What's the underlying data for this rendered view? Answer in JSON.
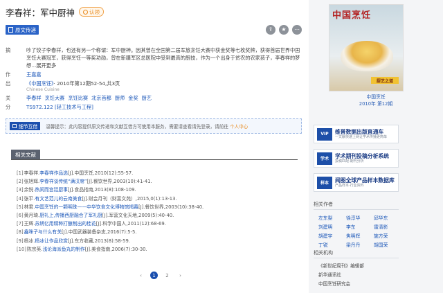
{
  "article": {
    "title": "李春祥：军中厨神",
    "auth_badge": "认领",
    "fulltext_button": "原文传递"
  },
  "tools": [
    {
      "name": "share-icon",
      "glyph": "⇪"
    },
    {
      "name": "favorite-icon",
      "glyph": "★"
    },
    {
      "name": "more-icon",
      "glyph": "⋯"
    }
  ],
  "meta": {
    "abstract_label": "摘",
    "abstract": "吵了饺子李春祥，也还有另一个称谓：军中厨神。因其曾在全国第二届军旅烹饪大赛中获金奖等七枚奖牌，获得首届世界中国烹饪大赛冠军，获得烹饪一等奖功勋，曾在新疆军区总医院中受到最高的厨技，作为一个出身于贫农的农家孩子，李春祥的梦想…展开更多",
    "author_label": "作",
    "author": "王嘉嘉",
    "source_label": "出",
    "source_link": "《中国烹饪》",
    "source_detail": "· 2010年第12期52-54,共3页",
    "source_en": "Chinese Cuisine",
    "keywords_label": "关",
    "keywords": [
      "李春祥",
      "烹饪大赛",
      "烹饪比赛",
      "北京首都",
      "厨师",
      "金奖",
      "厨艺"
    ],
    "class_label": "分",
    "class_value": "TS972.122 [轻工技术与工程]"
  },
  "notice": {
    "button": "细节互借",
    "text": "温馨提示：此内容提供原文传递和文献互借方可使用本服务，需要请查看请先登录，请前往",
    "link": "个人中心"
  },
  "related": {
    "tab": "相关文献",
    "items": [
      {
        "num": "[1]",
        "author": "李春祥.",
        "title": "李春祥作品选",
        "src": "[J].中国烹饪,2010(12):55-57."
      },
      {
        "num": "[2]",
        "author": "张旭辉.",
        "title": "李春祥谈传统“满汉席”",
        "src": "[J].餐饮世界,2003(10):41-41."
      },
      {
        "num": "[3]",
        "author": "余悦.",
        "title": "热闹而宫廷厨事",
        "src": "[J].食品指南,2013(8):108-109."
      },
      {
        "num": "[4]",
        "author": "张平.",
        "title": "有文艺范儿的云南美食",
        "src": "[J].财会月刊（财富文苑）,2015,0(1):13-13."
      },
      {
        "num": "[5]",
        "author": "林君.",
        "title": "中国烹饪的一颗明珠——中华饮食文化博物馆揭幕",
        "src": "[J].餐饮世界,2003(10):38-40."
      },
      {
        "num": "[6]",
        "author": "黄月琦.",
        "title": "厨礼上,传播西厨融合了军礼厨",
        "src": "[J].军营文化天地,2009(5):40-40."
      },
      {
        "num": "[7]",
        "author": "王辉.",
        "title": "苏绣亿用精粹打酿制出的桂花",
        "src": "[J].科学中国人,2011(12):68-69."
      },
      {
        "num": "[8]",
        "author": "",
        "title": "鑫咪子与什么有关",
        "src": "[J].中国武器装备杂志,2016(7):5-5."
      },
      {
        "num": "[9]",
        "author": "杨冰.",
        "title": "杨冰让作品欣赏",
        "src": "[J].东方收藏,2013(8):58-59."
      },
      {
        "num": "[10]",
        "author": "陈宗英.",
        "title": "浅论海派鱼丸的制作",
        "src": "[J].美食指南,2006(7):30-30."
      }
    ]
  },
  "pager": {
    "prev": "‹",
    "pages": [
      "1",
      "2"
    ],
    "next": "›"
  },
  "side": {
    "cover_logo": "中国烹饪",
    "cover_band": "厨艺之道",
    "cover_title": "中国烹饪",
    "cover_issue": "2010年 第12期",
    "banners": [
      {
        "icon": "VIP",
        "main": "维普数据出版直通车",
        "sub": "一文献快速上网让学术传播更简单"
      },
      {
        "icon": "学术",
        "main": "学术期刊投稿分析系统",
        "sub": "投稿匹配·期刊分析"
      },
      {
        "icon": "样本",
        "main": "阅图全球产品样本数据库",
        "sub": "产品样本·行业资料"
      }
    ],
    "authors_title": "相关作者",
    "authors": [
      "左东梨",
      "徐淳华",
      "邱华东",
      "刘建明",
      "李东",
      "雷清影",
      "胡建宇",
      "焦明辉",
      "施方荣",
      "丁锐",
      "梁丹丹",
      "胡国荣"
    ],
    "orgs_title": "相关机构",
    "orgs": [
      "《新世纪周刊》编辑部",
      "新华通讯社",
      "中国烹饪研究会"
    ]
  }
}
